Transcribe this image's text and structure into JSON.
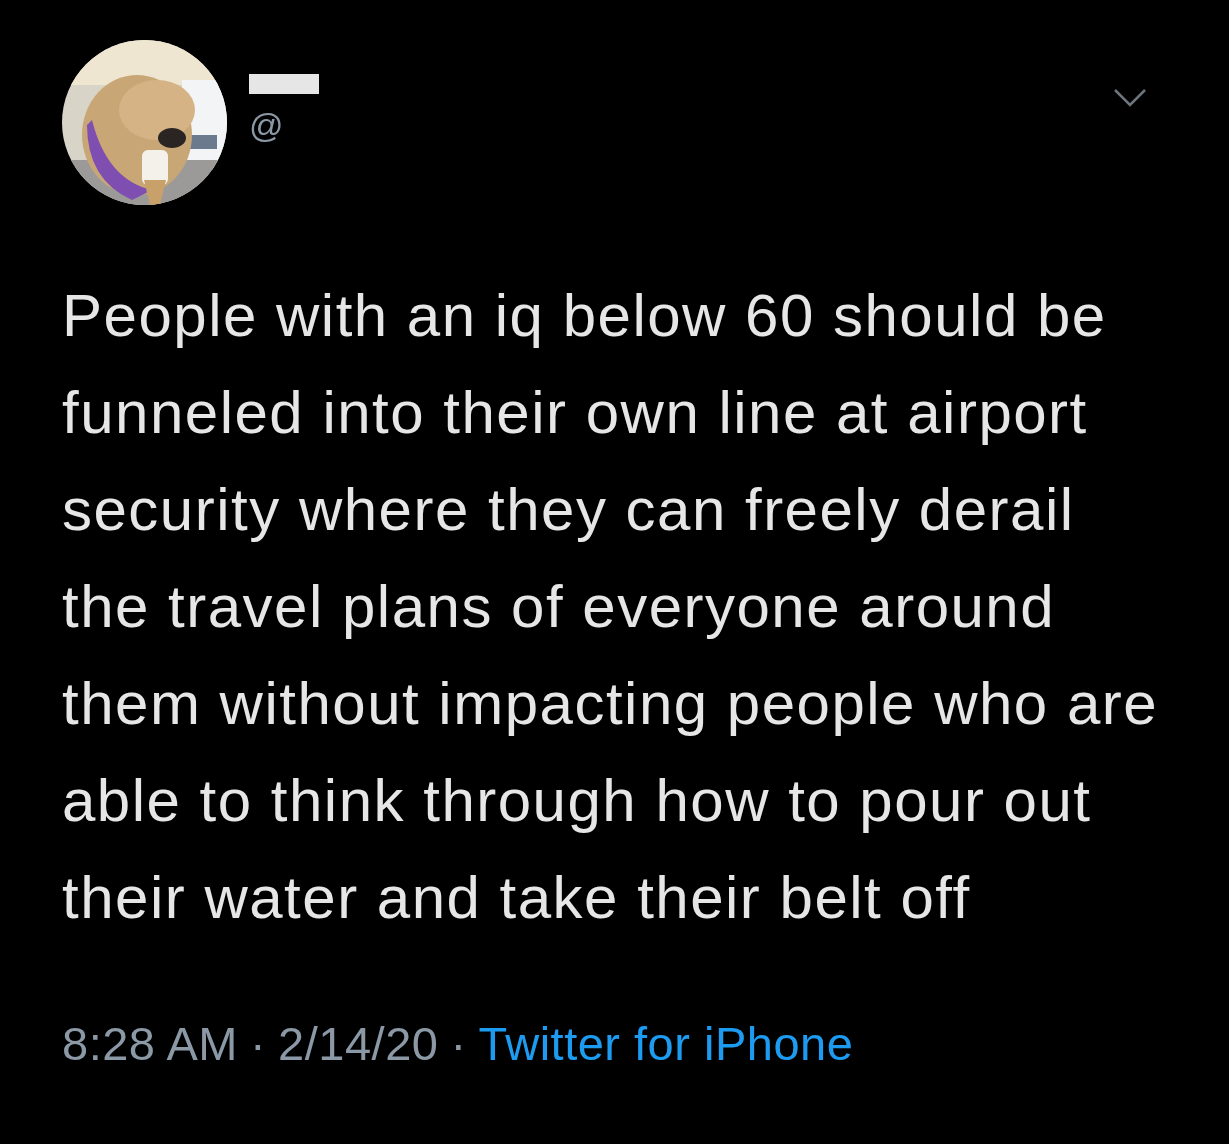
{
  "author": {
    "handle": "@",
    "name_redacted": true
  },
  "tweet_text": "People with an iq below 60 should be funneled into their own line at airport security where they can freely derail the travel plans of everyone around them without impacting people who are able to think through how to pour out their water and take their belt off",
  "footer": {
    "time": "8:28 AM",
    "separator": "·",
    "date": "2/14/20",
    "separator_2": "·",
    "source": "Twitter for iPhone"
  }
}
